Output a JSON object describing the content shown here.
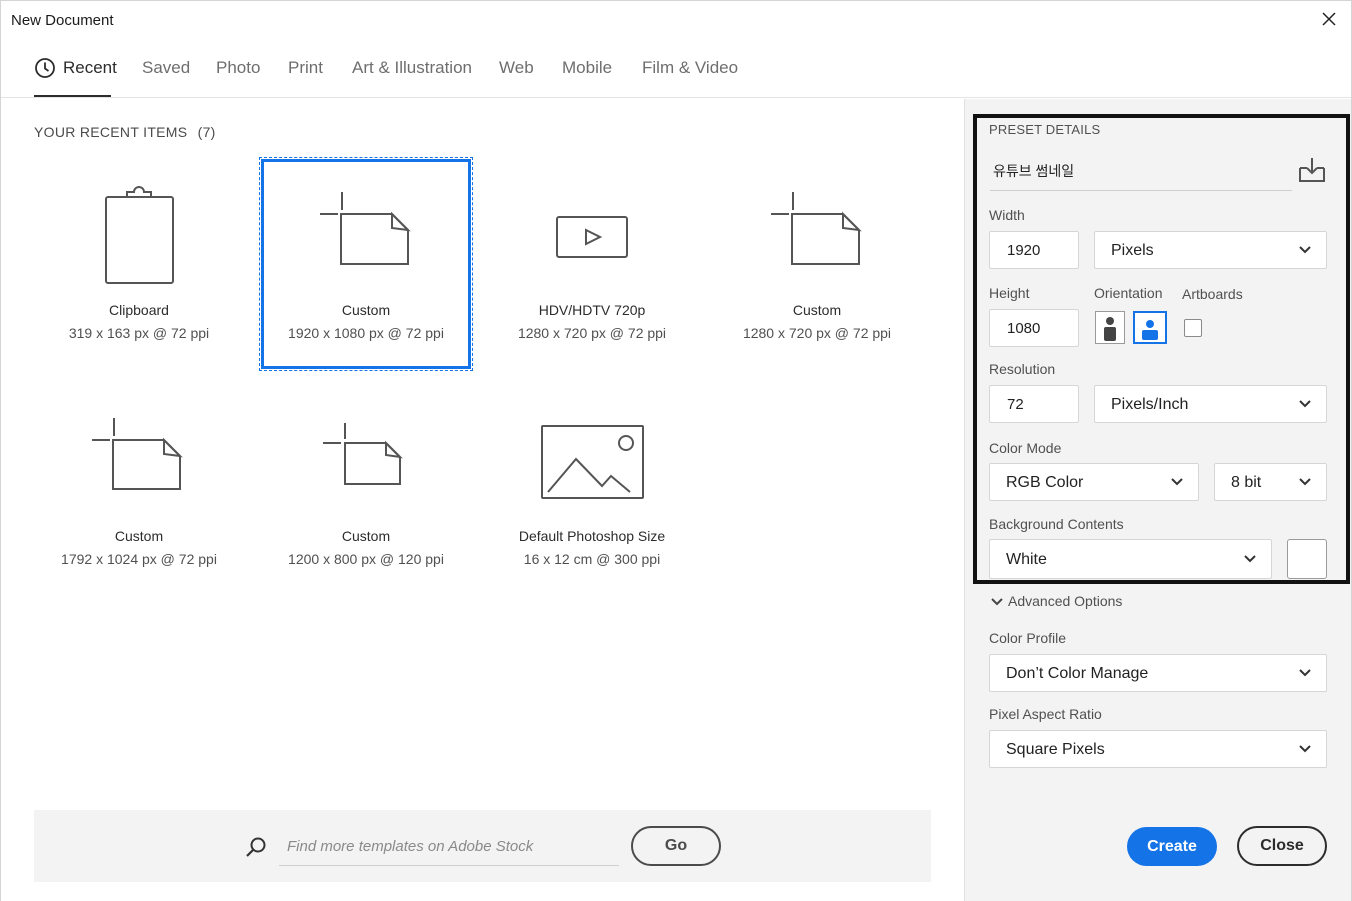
{
  "window": {
    "title": "New Document"
  },
  "tabs": [
    {
      "label": "Recent"
    },
    {
      "label": "Saved"
    },
    {
      "label": "Photo"
    },
    {
      "label": "Print"
    },
    {
      "label": "Art & Illustration"
    },
    {
      "label": "Web"
    },
    {
      "label": "Mobile"
    },
    {
      "label": "Film & Video"
    }
  ],
  "recent": {
    "heading": "YOUR RECENT ITEMS",
    "count": "(7)",
    "items": [
      {
        "name": "Clipboard",
        "meta": "319 x 163 px @ 72 ppi",
        "icon": "clipboard-icon"
      },
      {
        "name": "Custom",
        "meta": "1920 x 1080 px @ 72 ppi",
        "icon": "document-icon",
        "selected": true
      },
      {
        "name": "HDV/HDTV 720p",
        "meta": "1280 x 720 px @ 72 ppi",
        "icon": "video-icon"
      },
      {
        "name": "Custom",
        "meta": "1280 x 720 px @ 72 ppi",
        "icon": "document-icon"
      },
      {
        "name": "Custom",
        "meta": "1792 x 1024 px @ 72 ppi",
        "icon": "document-icon"
      },
      {
        "name": "Custom",
        "meta": "1200 x 800 px @ 120 ppi",
        "icon": "document-icon"
      },
      {
        "name": "Default Photoshop Size",
        "meta": "16 x 12 cm @ 300 ppi",
        "icon": "image-icon"
      }
    ]
  },
  "stock": {
    "placeholder": "Find more templates on Adobe Stock",
    "go_label": "Go"
  },
  "preset": {
    "heading": "PRESET DETAILS",
    "name": "유튜브 썸네일",
    "width_label": "Width",
    "width_value": "1920",
    "width_unit": "Pixels",
    "height_label": "Height",
    "height_value": "1080",
    "orientation_label": "Orientation",
    "orientation_selected": "landscape",
    "artboards_label": "Artboards",
    "artboards_checked": false,
    "resolution_label": "Resolution",
    "resolution_value": "72",
    "resolution_unit": "Pixels/Inch",
    "color_mode_label": "Color Mode",
    "color_mode": "RGB Color",
    "bit_depth": "8 bit",
    "background_label": "Background Contents",
    "background": "White",
    "background_color": "#ffffff"
  },
  "advanced": {
    "toggle_label": "Advanced Options",
    "color_profile_label": "Color Profile",
    "color_profile": "Don’t Color Manage",
    "pixel_aspect_label": "Pixel Aspect Ratio",
    "pixel_aspect": "Square Pixels"
  },
  "actions": {
    "create_label": "Create",
    "close_label": "Close"
  },
  "colors": {
    "accent": "#1473e6",
    "panel_bg": "#f3f3f3"
  }
}
